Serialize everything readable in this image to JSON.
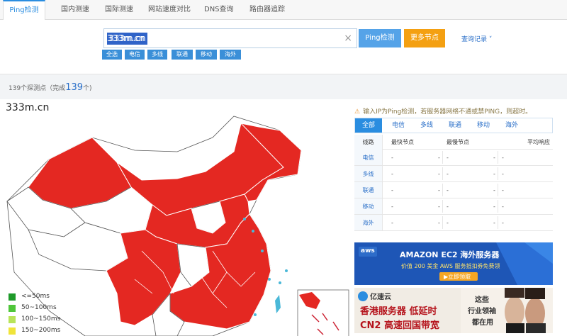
{
  "nav": {
    "tabs": [
      {
        "label": "Ping检测",
        "active": true
      },
      {
        "label": "国内测速",
        "active": false
      },
      {
        "label": "国际测速",
        "active": false
      },
      {
        "label": "网站速度对比",
        "active": false
      },
      {
        "label": "DNS查询",
        "active": false
      },
      {
        "label": "路由器追踪",
        "active": false
      }
    ]
  },
  "search": {
    "value": "333m.cn",
    "clear": "×",
    "ping_button": "Ping检测",
    "more_nodes_button": "更多节点",
    "history_link": "查询记录 ˅",
    "filters": [
      "全选",
      "电信",
      "多线",
      "联通",
      "移动",
      "海外"
    ]
  },
  "summary": {
    "prefix": "139个探测点（完成",
    "count": "139",
    "suffix": "个)"
  },
  "map": {
    "title": "333m.cn",
    "legend": [
      {
        "label": "<=50ms",
        "color": "#1e9a2a"
      },
      {
        "label": "50~100ms",
        "color": "#4fc63a"
      },
      {
        "label": "100~150ms",
        "color": "#b8e45a"
      },
      {
        "label": "150~200ms",
        "color": "#f0e43a"
      }
    ],
    "province_color": "#e42822"
  },
  "result": {
    "notice": "输入IP为Ping检测，若服务器网络不通或禁PING，则超时。",
    "notice_icon": "warning-icon",
    "isp_tabs": [
      "全部",
      "电信",
      "多线",
      "联通",
      "移动",
      "海外"
    ],
    "columns": [
      "线路",
      "最快节点",
      "最慢节点",
      "平均响应"
    ],
    "rows": [
      {
        "line": "电信",
        "fast": "-",
        "fast_val": "-",
        "slow": "-",
        "slow_val": "-",
        "avg": "-"
      },
      {
        "line": "多线",
        "fast": "-",
        "fast_val": "-",
        "slow": "-",
        "slow_val": "-",
        "avg": "-"
      },
      {
        "line": "联通",
        "fast": "-",
        "fast_val": "-",
        "slow": "-",
        "slow_val": "-",
        "avg": "-"
      },
      {
        "line": "移动",
        "fast": "-",
        "fast_val": "-",
        "slow": "-",
        "slow_val": "-",
        "avg": "-"
      },
      {
        "line": "海外",
        "fast": "-",
        "fast_val": "-",
        "slow": "-",
        "slow_val": "-",
        "avg": "-"
      }
    ]
  },
  "ads": {
    "aws": {
      "logo": "aws",
      "headline": "AMAZON EC2  海外服务器",
      "sub": "价值 200 美金 AWS 服务抵扣券免费领",
      "cta": "▶立即领取"
    },
    "yisu": {
      "logo": "亿速云",
      "line1": "香港服务器  低延时",
      "line2": "CN2 高速回国带宽",
      "tag1": "这些",
      "tag2": "行业领袖",
      "tag3": "都在用"
    }
  }
}
